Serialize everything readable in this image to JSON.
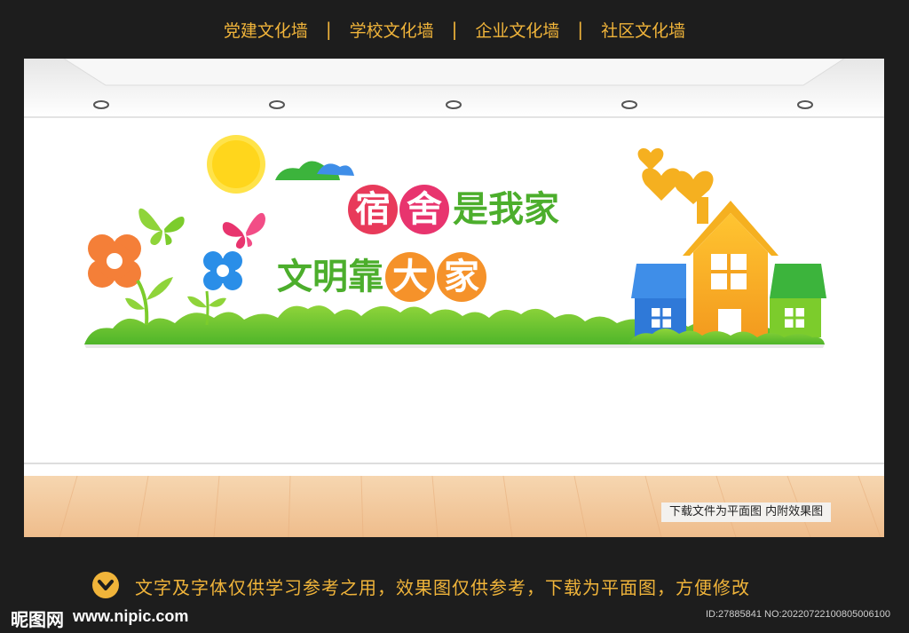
{
  "nav": {
    "items": [
      "党建文化墙",
      "学校文化墙",
      "企业文化墙",
      "社区文化墙"
    ],
    "separator": "|"
  },
  "scene": {
    "title_line1": {
      "chars": [
        "宿",
        "舍",
        "是",
        "我",
        "家"
      ]
    },
    "title_line2": {
      "chars": [
        "文",
        "明",
        "靠",
        "大",
        "家"
      ]
    },
    "note": "下载文件为平面图  内附效果图"
  },
  "footer": {
    "icon": "chevron-down-icon",
    "disclaimer": "文字及字体仅供学习参考之用，效果图仅供参考，下载为平面图，方便修改",
    "brand": "昵图网",
    "brand_url": "www.nipic.com",
    "image_id": "ID:27885841 NO:20220722100805006100"
  },
  "colors": {
    "background": "#1d1d1d",
    "accent": "#f0b43a",
    "title_green": "#4cae2c",
    "circle_red": "#e83a5a",
    "circle_pink": "#e8346e",
    "circle_orange": "#f5922a",
    "floor": "#f2c79a"
  }
}
